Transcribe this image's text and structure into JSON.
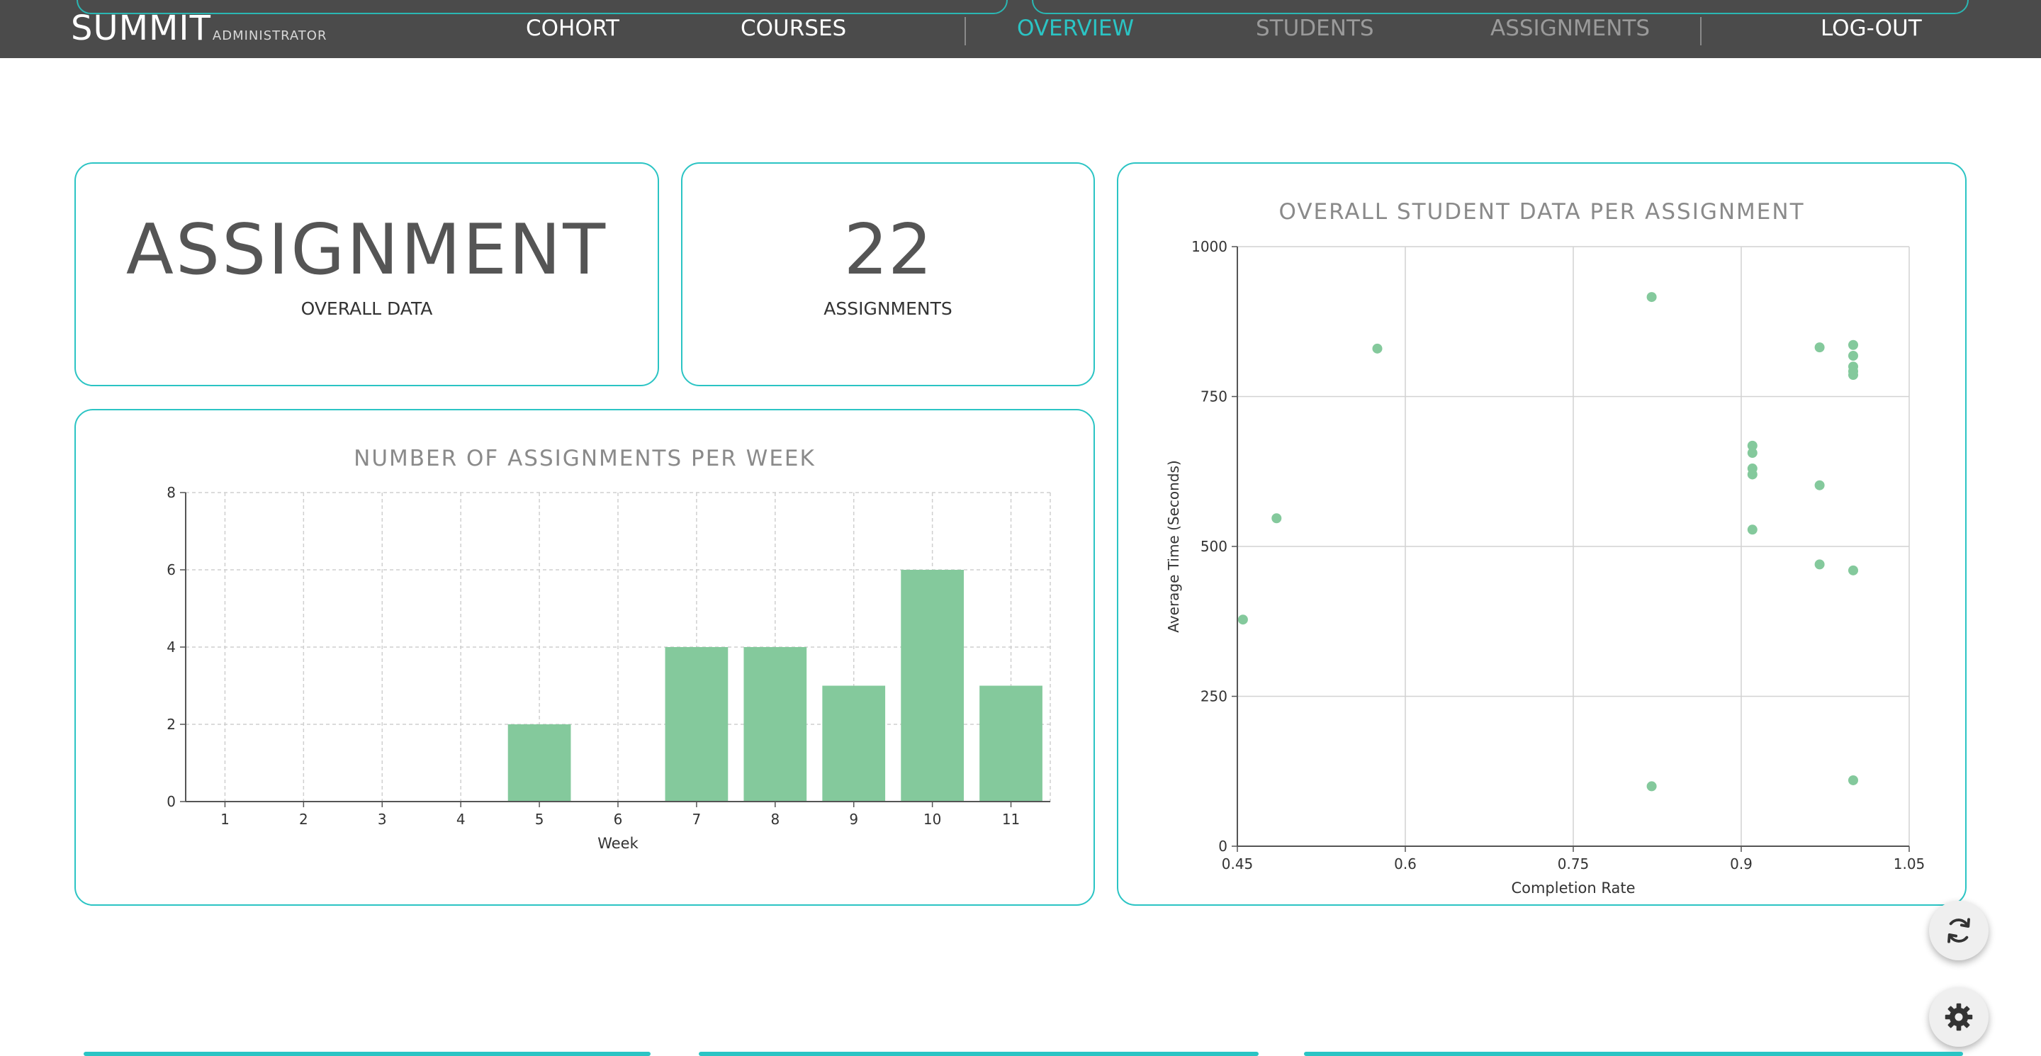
{
  "nav": {
    "brand": "SUMMIT",
    "brand_sub": "ADMINISTRATOR",
    "links": [
      "COHORT",
      "COURSES",
      "OVERVIEW",
      "STUDENTS",
      "ASSIGNMENTS",
      "LOG-OUT"
    ],
    "active": "OVERVIEW"
  },
  "summary": {
    "title": "ASSIGNMENT",
    "title_sub": "OVERALL DATA",
    "count": "22",
    "count_label": "ASSIGNMENTS"
  },
  "colors": {
    "accent": "#2bc4c4",
    "bar": "#84c99c",
    "point": "#84c99c",
    "nav_bg": "#4b4b4b"
  },
  "icons": {
    "refresh": "refresh-icon",
    "settings": "gear-icon"
  },
  "chart_data": [
    {
      "type": "bar",
      "title": "NUMBER OF ASSIGNMENTS PER WEEK",
      "xlabel": "Week",
      "ylabel": "",
      "categories": [
        "1",
        "2",
        "3",
        "4",
        "5",
        "6",
        "7",
        "8",
        "9",
        "10",
        "11"
      ],
      "values": [
        0,
        0,
        0,
        0,
        2,
        0,
        4,
        4,
        3,
        6,
        3
      ],
      "ylim": [
        0,
        8
      ],
      "yticks": [
        0,
        2,
        4,
        6,
        8
      ],
      "grid": "dashed"
    },
    {
      "type": "scatter",
      "title": "OVERALL STUDENT DATA PER ASSIGNMENT",
      "xlabel": "Completion Rate",
      "ylabel": "Average Time (Seconds)",
      "xlim": [
        0.45,
        1.05
      ],
      "ylim": [
        0,
        1000
      ],
      "xticks": [
        0.45,
        0.6,
        0.75,
        0.9,
        1.05
      ],
      "yticks": [
        0,
        250,
        500,
        750,
        1000
      ],
      "points": [
        {
          "x": 0.455,
          "y": 378
        },
        {
          "x": 0.485,
          "y": 547
        },
        {
          "x": 0.575,
          "y": 830
        },
        {
          "x": 0.82,
          "y": 916
        },
        {
          "x": 0.82,
          "y": 100
        },
        {
          "x": 0.91,
          "y": 668
        },
        {
          "x": 0.91,
          "y": 656
        },
        {
          "x": 0.91,
          "y": 630
        },
        {
          "x": 0.91,
          "y": 620
        },
        {
          "x": 0.91,
          "y": 528
        },
        {
          "x": 0.97,
          "y": 832
        },
        {
          "x": 0.97,
          "y": 602
        },
        {
          "x": 0.97,
          "y": 470
        },
        {
          "x": 1.0,
          "y": 836
        },
        {
          "x": 1.0,
          "y": 818
        },
        {
          "x": 1.0,
          "y": 800
        },
        {
          "x": 1.0,
          "y": 792
        },
        {
          "x": 1.0,
          "y": 786
        },
        {
          "x": 1.0,
          "y": 460
        },
        {
          "x": 1.0,
          "y": 110
        }
      ]
    }
  ]
}
